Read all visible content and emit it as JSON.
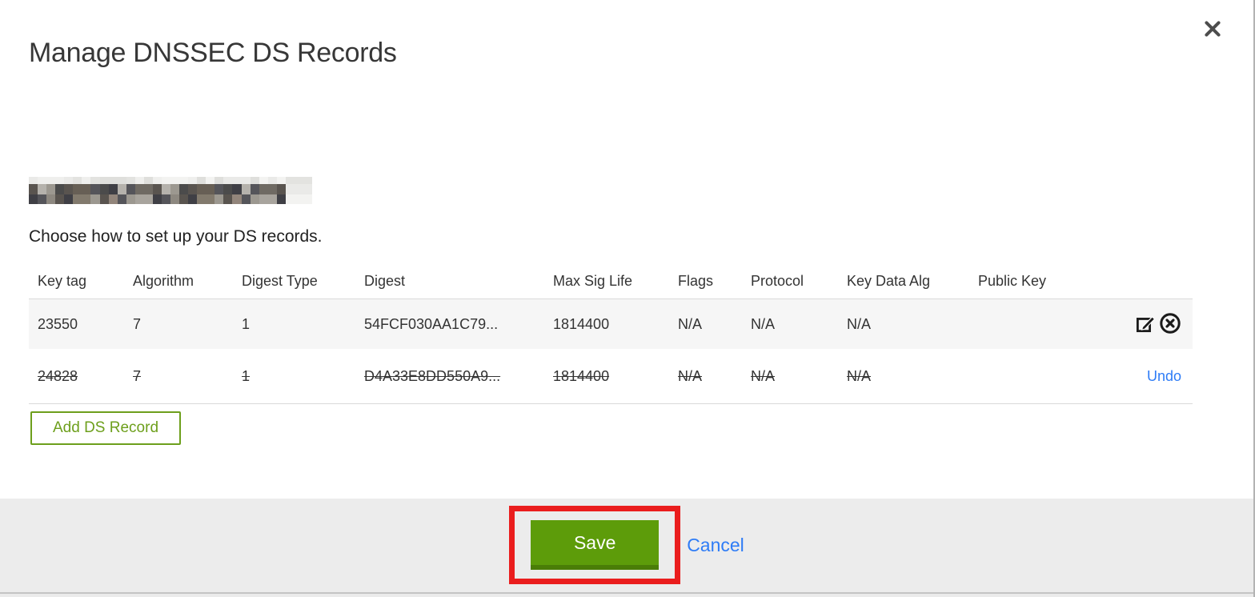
{
  "window": {
    "title": "Manage DNSSEC DS Records",
    "instruction": "Choose how to set up your DS records.",
    "table": {
      "headers": [
        "Key tag",
        "Algorithm",
        "Digest Type",
        "Digest",
        "Max Sig Life",
        "Flags",
        "Protocol",
        "Key Data Alg",
        "Public Key"
      ],
      "rows": [
        {
          "key_tag": "23550",
          "algorithm": "7",
          "digest_type": "1",
          "digest": "54FCF030AA1C79...",
          "max_sig_life": "1814400",
          "flags": "N/A",
          "protocol": "N/A",
          "key_data_alg": "N/A",
          "public_key": "",
          "state": "active"
        },
        {
          "key_tag": "24828",
          "algorithm": "7",
          "digest_type": "1",
          "digest": "D4A33E8DD550A9...",
          "max_sig_life": "1814400",
          "flags": "N/A",
          "protocol": "N/A",
          "key_data_alg": "N/A",
          "public_key": "",
          "state": "deleted",
          "undo_label": "Undo"
        }
      ]
    },
    "add_ds_record_label": "Add DS Record",
    "footer": {
      "save_label": "Save",
      "cancel_label": "Cancel"
    },
    "icons": {
      "close": "close-icon",
      "edit": "edit-icon",
      "delete": "delete-circle-icon"
    },
    "colors": {
      "save_green": "#5d9c0a",
      "save_green_dark": "#4a7d07",
      "outline_green": "#6d9f1c",
      "link_blue": "#2e7cf6",
      "annotation_red": "#ea1d1d",
      "row_stripe": "#f6f6f6",
      "footer_gray": "#ececec"
    }
  }
}
